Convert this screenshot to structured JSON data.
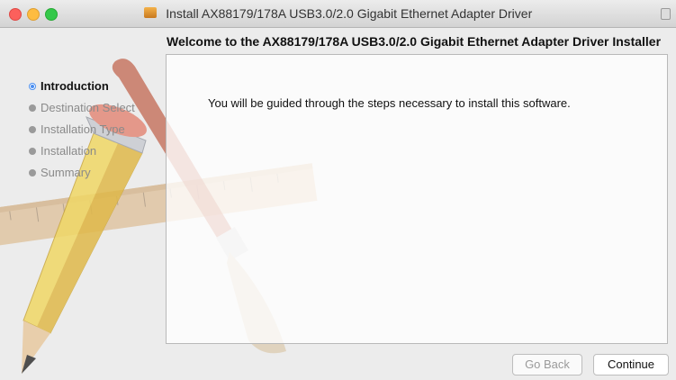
{
  "window": {
    "title": "Install AX88179/178A USB3.0/2.0 Gigabit Ethernet Adapter Driver"
  },
  "header": {
    "heading": "Welcome to the AX88179/178A USB3.0/2.0 Gigabit Ethernet Adapter Driver Installer"
  },
  "sidebar": {
    "steps": [
      {
        "label": "Introduction",
        "active": true
      },
      {
        "label": "Destination Select",
        "active": false
      },
      {
        "label": "Installation Type",
        "active": false
      },
      {
        "label": "Installation",
        "active": false
      },
      {
        "label": "Summary",
        "active": false
      }
    ]
  },
  "main": {
    "message": "You will be guided through the steps necessary to install this software."
  },
  "buttons": {
    "back_label": "Go Back",
    "continue_label": "Continue"
  },
  "colors": {
    "accent": "#4a8ef0",
    "close": "#fc605c",
    "minimize": "#fdbc40",
    "zoom": "#34c84a"
  },
  "icons": {
    "title": "installer-package-icon",
    "close": "close-icon",
    "minimize": "minimize-icon",
    "zoom": "zoom-icon",
    "lock": "lock-icon"
  }
}
